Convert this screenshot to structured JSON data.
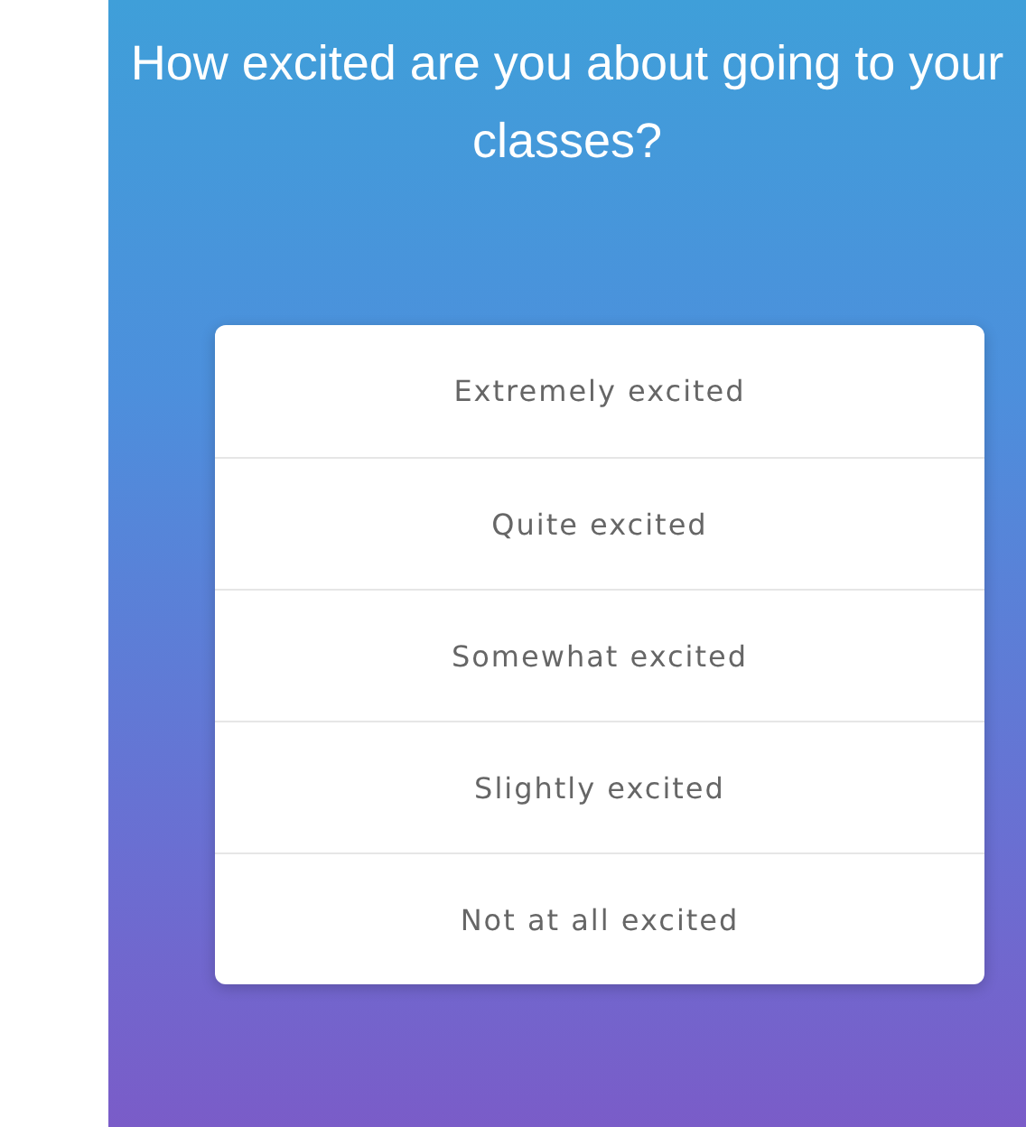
{
  "question": "How excited are you about going to your classes?",
  "options": [
    {
      "label": "Extremely excited"
    },
    {
      "label": "Quite excited"
    },
    {
      "label": "Somewhat excited"
    },
    {
      "label": "Slightly excited"
    },
    {
      "label": "Not at all excited"
    }
  ]
}
